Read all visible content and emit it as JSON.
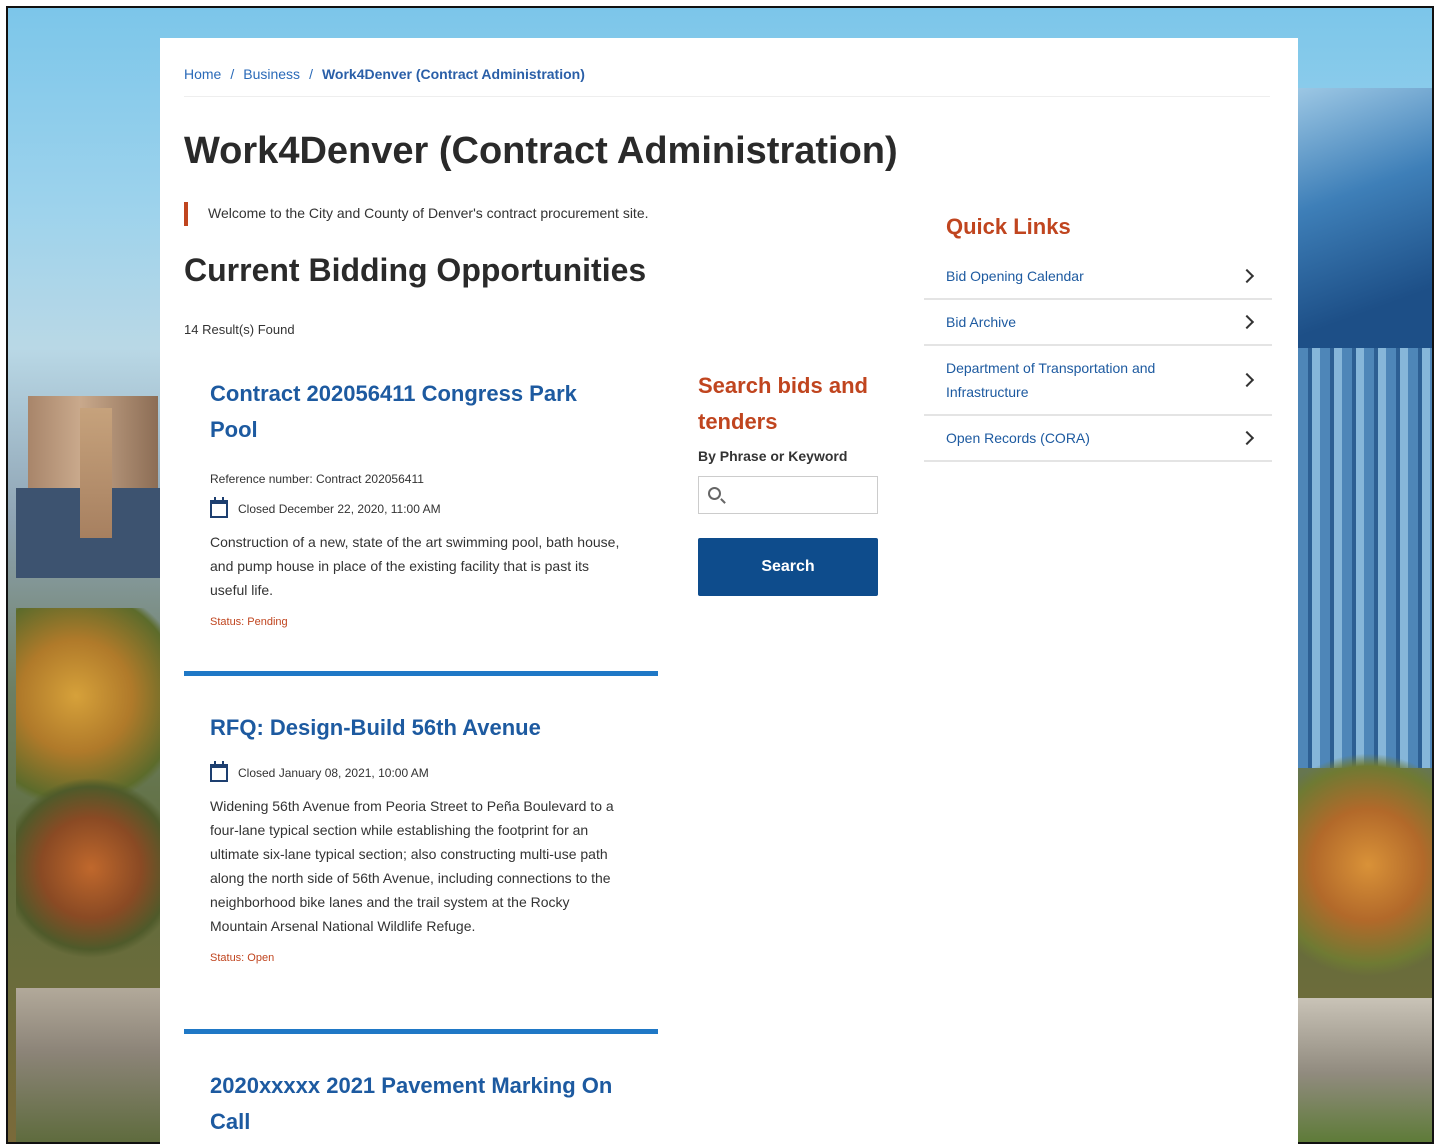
{
  "breadcrumb": {
    "home": "Home",
    "business": "Business",
    "current": "Work4Denver (Contract Administration)",
    "separator": "/"
  },
  "page_title": "Work4Denver (Contract Administration)",
  "welcome": "Welcome to the City and County of Denver's contract procurement site.",
  "section_title": "Current Bidding Opportunities",
  "results_count": "14 Result(s) Found",
  "cards": [
    {
      "title": "Contract 202056411 Congress Park Pool",
      "reference": "Reference number: Contract 202056411",
      "date": "Closed December 22, 2020, 11:00 AM",
      "description": "Construction of a new, state of the art swimming pool, bath house, and pump house in place of the existing facility that is past its useful life.",
      "status": "Status: Pending"
    },
    {
      "title": "RFQ: Design-Build 56th Avenue",
      "date": "Closed January 08, 2021, 10:00 AM",
      "description": "Widening 56th Avenue from Peoria Street to Peña Boulevard to a four-lane typical section while establishing the footprint for an ultimate six-lane typical section; also constructing multi-use path along the north side of 56th Avenue, including connections to the neighborhood bike lanes and the trail system at the Rocky Mountain Arsenal National Wildlife Refuge.",
      "status": "Status: Open"
    },
    {
      "title": "2020xxxxx 2021 Pavement Marking On Call"
    }
  ],
  "search": {
    "heading": "Search bids and tenders",
    "label": "By Phrase or Keyword",
    "value": "",
    "button": "Search"
  },
  "quick_links": {
    "title": "Quick Links",
    "items": [
      {
        "label": "Bid Opening Calendar"
      },
      {
        "label": "Bid Archive"
      },
      {
        "label": "Department of Transportation and Infrastructure"
      },
      {
        "label": "Open Records (CORA)"
      }
    ]
  },
  "colors": {
    "accent": "#c0451f",
    "link": "#1d5aa0",
    "button": "#0e4c8c",
    "card_rule": "#1f78c6"
  }
}
